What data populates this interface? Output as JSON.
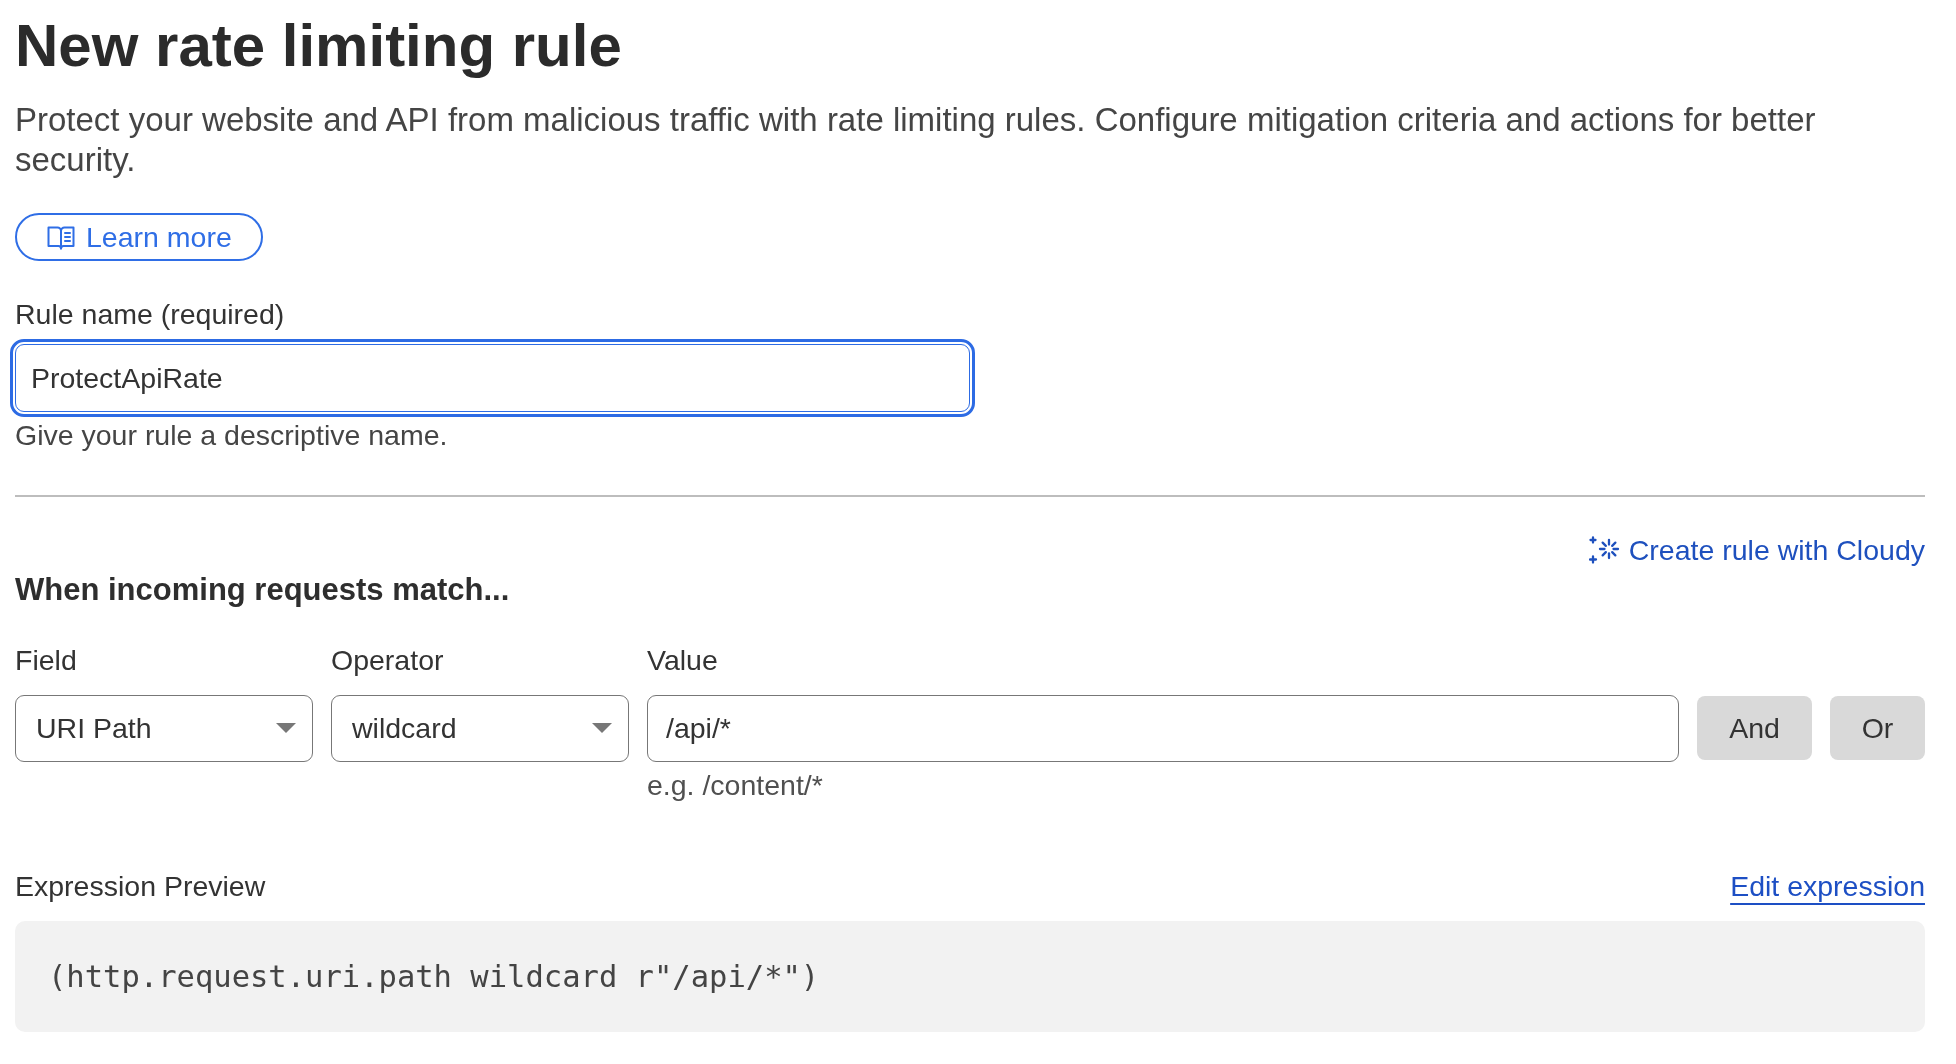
{
  "page": {
    "title": "New rate limiting rule",
    "description": "Protect your website and API from malicious traffic with rate limiting rules. Configure mitigation criteria and actions for better security."
  },
  "learn_more_button": {
    "label": "Learn more"
  },
  "rule_name": {
    "label": "Rule name (required)",
    "value": "ProtectApiRate",
    "focused": true,
    "helper": "Give your rule a descriptive name."
  },
  "cloudy_link": {
    "label": "Create rule with Cloudy"
  },
  "match_section": {
    "heading": "When incoming requests match...",
    "conditions": [
      {
        "kind": "select",
        "label": "Field",
        "value": "URI Path"
      },
      {
        "kind": "select",
        "label": "Operator",
        "value": "wildcard"
      },
      {
        "kind": "input",
        "label": "Value",
        "value": "/api/*",
        "hint": "e.g. /content/*"
      }
    ],
    "buttons": [
      "And",
      "Or"
    ]
  },
  "expression_preview": {
    "label": "Expression Preview",
    "edit_link": "Edit expression",
    "code": "(http.request.uri.path wildcard r\"/api/*\")"
  }
}
